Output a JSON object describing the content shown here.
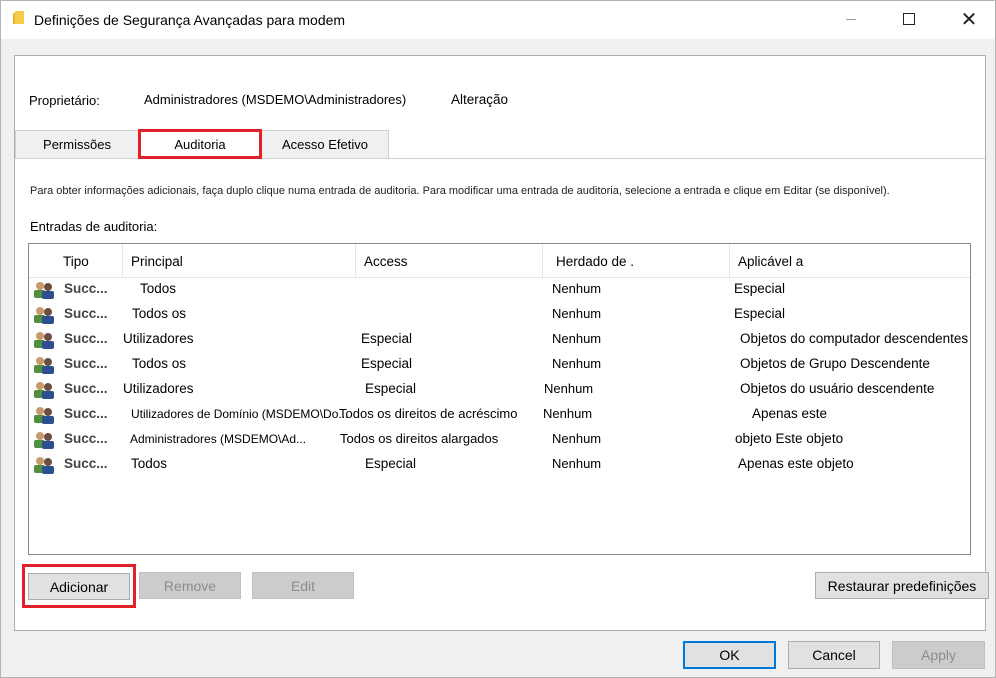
{
  "window": {
    "title": "Definições de Segurança Avançadas para modem",
    "minimize_icon": "minimize-icon",
    "maximize_icon": "maximize-icon",
    "close_glyph": "✕"
  },
  "owner": {
    "label": "Proprietário:",
    "value": "Administradores (MSDEMO\\Administradores)",
    "change_link": "Alteração"
  },
  "tabs": [
    {
      "label": "Permissões"
    },
    {
      "label": "Auditoria",
      "selected": true
    },
    {
      "label": "Acesso Efetivo"
    }
  ],
  "audit": {
    "info_text": "Para obter informações adicionais, faça duplo clique numa entrada de auditoria. Para modificar uma entrada de auditoria, selecione a entrada e clique em Editar (se disponível).",
    "entries_label": "Entradas de auditoria:",
    "columns": [
      "Tipo",
      "Principal",
      "Access",
      "Herdado de .",
      "Aplicável a"
    ],
    "rows": [
      {
        "type": "Succ...",
        "principal": "Todos",
        "access": "",
        "inherited": "Nenhum",
        "applies": "Especial"
      },
      {
        "type": "Succ...",
        "principal": "Todos os",
        "access": "",
        "inherited": "Nenhum",
        "applies": "Especial"
      },
      {
        "type": "Succ...",
        "principal": "Utilizadores",
        "access": "Especial",
        "inherited": "Nenhum",
        "applies": "Objetos do computador descendentes"
      },
      {
        "type": "Succ...",
        "principal": "Todos os",
        "access": "Especial",
        "inherited": "Nenhum",
        "applies": "Objetos de Grupo Descendente"
      },
      {
        "type": "Succ...",
        "principal": "Utilizadores",
        "access": "Especial",
        "inherited": "Nenhum",
        "applies": "Objetos do usuário descendente"
      },
      {
        "type": "Succ...",
        "principal": "Utilizadores de Domínio (MSDEMO\\Do...",
        "access": "Todos os direitos de acréscimo",
        "inherited": "Nenhum",
        "applies": "Apenas este"
      },
      {
        "type": "Succ...",
        "principal": "Administradores (MSDEMO\\Ad...",
        "access": "Todos os direitos alargados",
        "inherited": "Nenhum",
        "applies": "objeto Este objeto"
      },
      {
        "type": "Succ...",
        "principal": "Todos",
        "access": "Especial",
        "inherited": "Nenhum",
        "applies": "Apenas este objeto"
      }
    ],
    "row_icon": "users-icon"
  },
  "buttons": {
    "add": "Adicionar",
    "remove": "Remove",
    "edit": "Edit",
    "restore": "Restaurar predefinições",
    "ok": "OK",
    "cancel": "Cancel",
    "apply": "Apply"
  },
  "colors": {
    "highlight": "#e3202a",
    "focus_border": "#0078d7"
  }
}
